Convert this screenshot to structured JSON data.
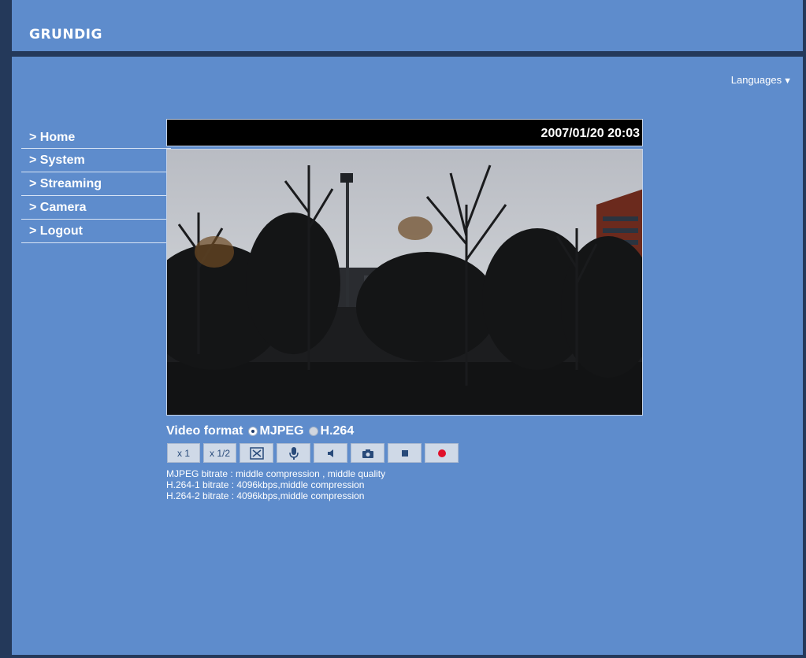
{
  "header": {
    "logo": "GRUNDIG"
  },
  "languages_label": "Languages",
  "nav": {
    "items": [
      {
        "label": "> Home"
      },
      {
        "label": "> System"
      },
      {
        "label": "> Streaming"
      },
      {
        "label": "> Camera"
      },
      {
        "label": "> Logout"
      }
    ]
  },
  "viewer": {
    "timestamp": "2007/01/20 20:03"
  },
  "video_format": {
    "label": "Video format",
    "options": [
      {
        "label": "MJPEG",
        "selected": true
      },
      {
        "label": "H.264",
        "selected": false
      }
    ]
  },
  "toolbar": {
    "zoom_x1": "x 1",
    "zoom_half": "x 1/2",
    "icons": [
      "fullscreen-icon",
      "microphone-icon",
      "speaker-icon",
      "snapshot-icon",
      "stop-icon",
      "record-icon"
    ]
  },
  "info": {
    "lines": [
      "MJPEG bitrate : middle compression , middle quality",
      "H.264-1 bitrate : 4096kbps,middle compression",
      "H.264-2 bitrate : 4096kbps,middle compression"
    ]
  },
  "colors": {
    "background": "#5e8ccc",
    "frame": "#24395a",
    "button": "#cfd9e7",
    "record": "#e0102a"
  }
}
